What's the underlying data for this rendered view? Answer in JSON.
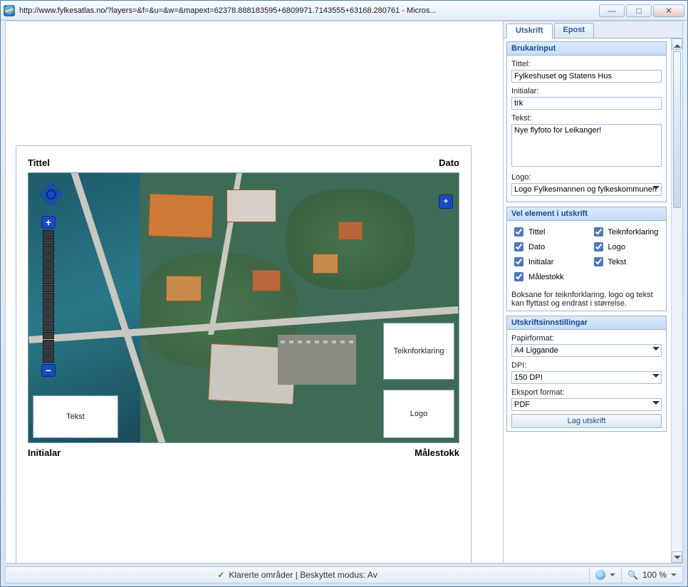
{
  "window": {
    "title": "http://www.fylkesatlas.no/?layers=&f=&u=&w=&mapext=62378.888183595+6809971.7143555+63168.280761 - Micros..."
  },
  "tabs": {
    "active": "Utskrift",
    "inactive": "Epost"
  },
  "preview": {
    "tittel_label": "Tittel",
    "dato_label": "Dato",
    "initialar_label": "Initialar",
    "malestokk_label": "Målestokk",
    "tekst_box": "Tekst",
    "teikn_box": "Teiknforklaring",
    "logo_box": "Logo"
  },
  "brukarinput": {
    "header": "Brukarinput",
    "tittel_label": "Tittel:",
    "tittel_value": "Fylkeshuset og Statens Hus",
    "initialar_label": "Initialar:",
    "initialar_value": "trk",
    "tekst_label": "Tekst:",
    "tekst_value": "Nye flyfoto for Leikanger!",
    "logo_label": "Logo:",
    "logo_value": "Logo Fylkesmannen og fylkeskommunen"
  },
  "vel_element": {
    "header": "Vel element i utskrift",
    "items": {
      "tittel": "Tittel",
      "dato": "Dato",
      "initialar": "Initialar",
      "malestokk": "Målestokk",
      "teiknforklaring": "Teiknforklaring",
      "logo": "Logo",
      "tekst": "Tekst"
    },
    "help": "Boksane for teiknforklaring, logo og tekst kan flyttast og endrast i størrelse."
  },
  "utskriftsinnstillingar": {
    "header": "Utskriftsinnstillingar",
    "papir_label": "Papirformat:",
    "papir_value": "A4 Liggande",
    "dpi_label": "DPI:",
    "dpi_value": "150 DPI",
    "eksport_label": "Eksport format:",
    "eksport_value": "PDF",
    "button": "Lag utskrift"
  },
  "statusbar": {
    "trusted": "Klarerte områder | Beskyttet modus: Av",
    "zoom": "100 %"
  }
}
